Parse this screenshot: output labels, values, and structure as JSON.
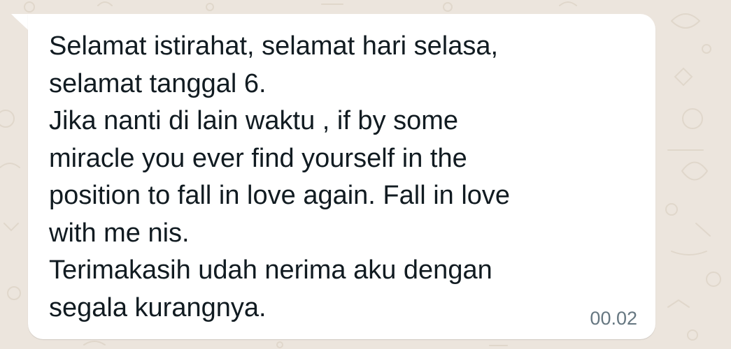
{
  "chat": {
    "background_color": "#ece5dd",
    "bubble_color": "#ffffff",
    "text_color": "#111b21",
    "time_color": "#667781",
    "message": {
      "direction": "incoming",
      "text": "Selamat istirahat, selamat hari selasa,\nselamat tanggal 6.\nJika nanti di lain waktu , if by some\nmiracle you ever find yourself in the\nposition to fall in love again. Fall in love\nwith me nis.\nTerimakasih udah nerima aku dengan\nsegala kurangnya.",
      "time": "00.02"
    }
  }
}
